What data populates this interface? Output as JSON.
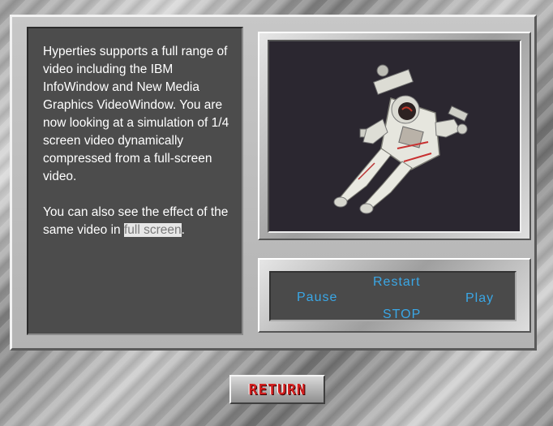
{
  "text_panel": {
    "para1": "Hyperties supports a full range of video including the IBM InfoWindow and New Media Graphics VideoWindow.  You are now looking at a simulation of 1/4 screen video dynamically compressed from a full-screen video.",
    "para2_prefix": "You can also see the effect of the same video in ",
    "link": "full screen",
    "para2_suffix": "."
  },
  "video": {
    "subject_icon": "astronaut-image"
  },
  "controls": {
    "restart": "Restart",
    "pause": "Pause",
    "play": "Play",
    "stop": "STOP",
    "color": "#3aa7e6"
  },
  "return_button": {
    "label": "RETURN",
    "color": "#d42020"
  }
}
